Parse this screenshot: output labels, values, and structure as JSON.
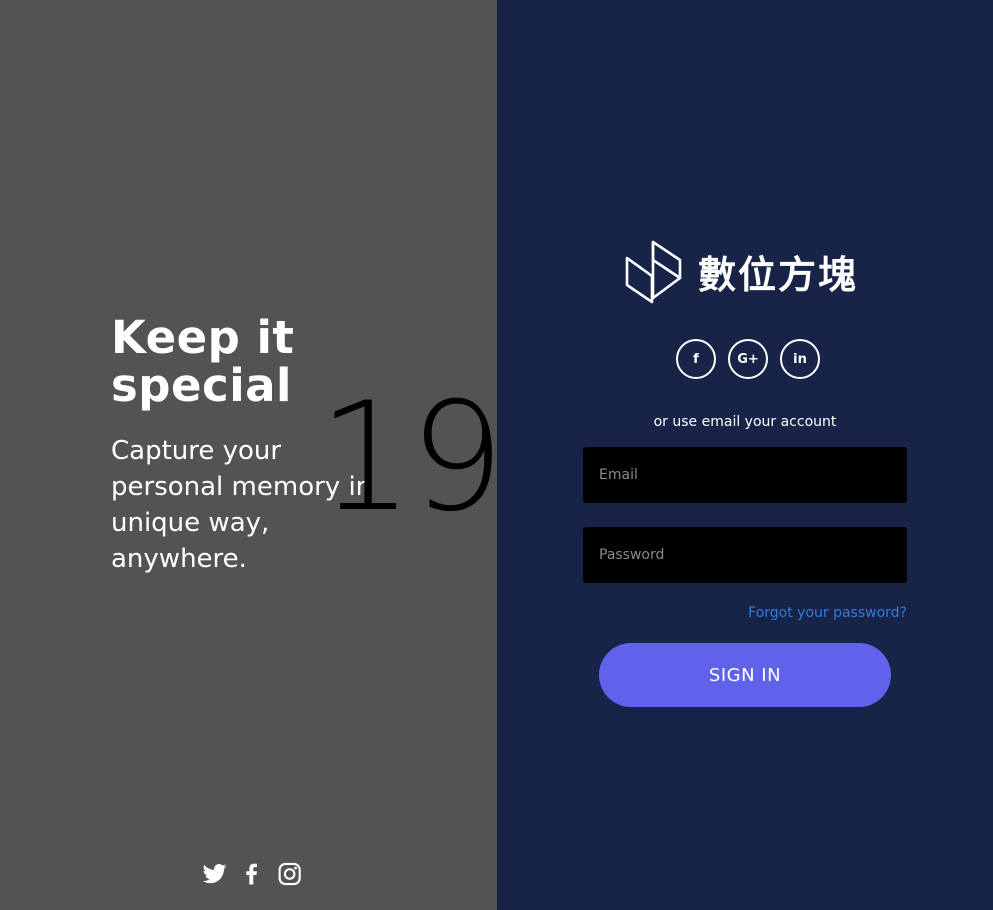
{
  "left": {
    "title": "Keep it special",
    "subtitle": "Capture your personal memory in unique way, anywhere.",
    "big_number": "19",
    "social_icons": [
      "twitter-icon",
      "facebook-icon",
      "instagram-icon"
    ]
  },
  "right": {
    "logo_text": "數位方塊",
    "social_buttons": [
      {
        "label": "f",
        "icon": "facebook-icon"
      },
      {
        "label": "G+",
        "icon": "google-plus-icon"
      },
      {
        "label": "in",
        "icon": "linkedin-icon"
      }
    ],
    "or_text": "or use email your account",
    "email_placeholder": "Email",
    "password_placeholder": "Password",
    "forgot_label": "Forgot your password?",
    "signin_label": "SIGN IN"
  },
  "colors": {
    "left_bg": "#535353",
    "right_bg": "#172448",
    "accent": "#6062ec",
    "link": "#2f7be0"
  }
}
